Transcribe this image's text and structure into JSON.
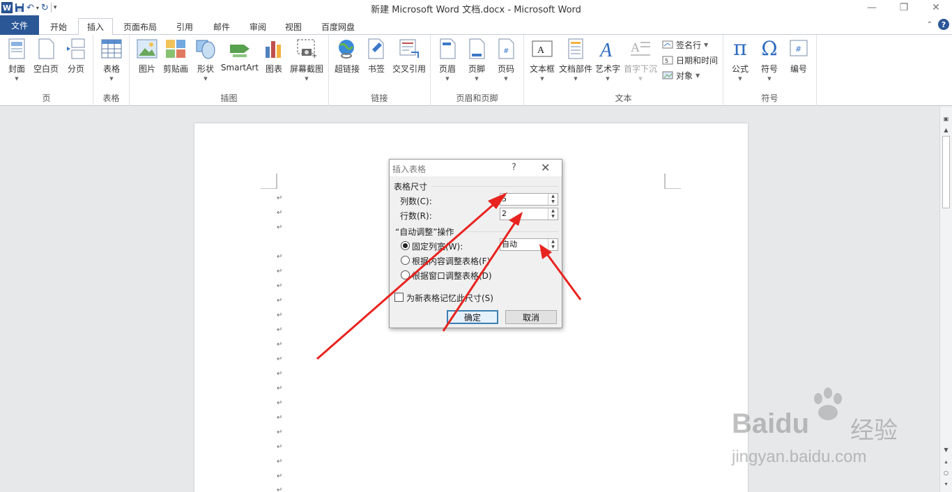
{
  "window": {
    "title": "新建 Microsoft Word 文档.docx  -  Microsoft Word",
    "min": "—",
    "restore": "❐",
    "close": "✕"
  },
  "tabs": {
    "file": "文件",
    "items": [
      "开始",
      "插入",
      "页面布局",
      "引用",
      "邮件",
      "审阅",
      "视图",
      "百度网盘"
    ],
    "active": "插入"
  },
  "ribbon": {
    "groups": {
      "pages": {
        "label": "页",
        "buttons": [
          "封面",
          "空白页",
          "分页"
        ]
      },
      "tables": {
        "label": "表格",
        "buttons": [
          "表格"
        ]
      },
      "illustrations": {
        "label": "插图",
        "buttons": [
          "图片",
          "剪贴画",
          "形状",
          "SmartArt",
          "图表",
          "屏幕截图"
        ]
      },
      "links": {
        "label": "链接",
        "buttons": [
          "超链接",
          "书签",
          "交叉引用"
        ]
      },
      "header_footer": {
        "label": "页眉和页脚",
        "buttons": [
          "页眉",
          "页脚",
          "页码"
        ]
      },
      "text": {
        "label": "文本",
        "buttons": [
          "文本框",
          "文档部件",
          "艺术字",
          "首字下沉"
        ],
        "small": [
          "签名行",
          "日期和时间",
          "对象"
        ]
      },
      "symbols": {
        "label": "符号",
        "buttons": [
          "公式",
          "符号",
          "编号"
        ]
      }
    }
  },
  "dialog": {
    "title": "插入表格",
    "help": "?",
    "close": "✕",
    "size_section": "表格尺寸",
    "columns_label": "列数(C):",
    "columns_value": "5",
    "rows_label": "行数(R):",
    "rows_value": "2",
    "autofit_section": "“自动调整”操作",
    "fixed_label": "固定列宽(W):",
    "fixed_value": "自动",
    "content_label": "根据内容调整表格(F)",
    "window_label": "根据窗口调整表格(D)",
    "remember_label": "为新表格记忆此尺寸(S)",
    "ok": "确定",
    "cancel": "取消"
  },
  "paragraph_mark": "↵",
  "watermark": {
    "brand": "Baidu",
    "cn": "经验",
    "url": "jingyan.baidu.com"
  },
  "colors": {
    "accent": "#2b5797",
    "arrow": "#e8231f"
  }
}
